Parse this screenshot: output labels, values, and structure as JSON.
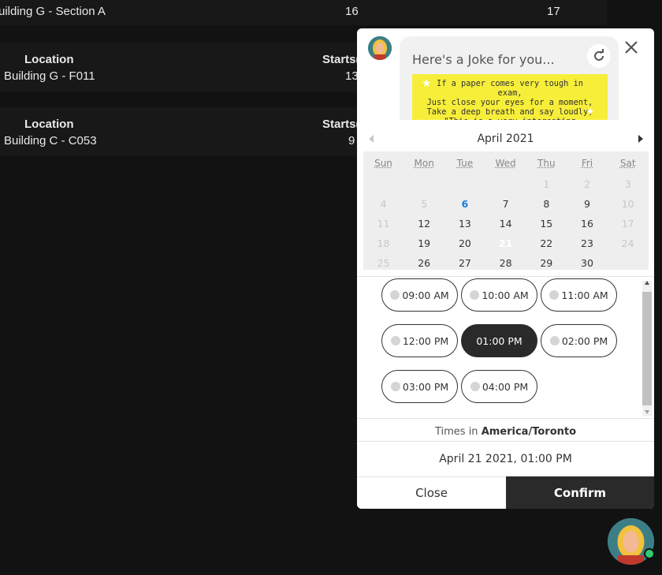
{
  "background_table": {
    "row1": {
      "location": "uilding G - Section A",
      "start": "16",
      "end": "17"
    },
    "row2": {
      "location_header": "Location",
      "starts_header": "Starts(",
      "location": "Building G - F011",
      "start": "13"
    },
    "row3": {
      "location_header": "Location",
      "starts_header": "Starts(",
      "location": "Building C - C053",
      "start": "9"
    }
  },
  "widget": {
    "joke_title": "Here's a Joke for you...",
    "joke_text_lines": [
      "If a paper comes very tough in",
      "exam,",
      "Just close your eyes for a moment,",
      "Take a deep breath and say loudly,",
      "\"This is a very interesting"
    ],
    "calendar": {
      "month_year": "April  2021",
      "weekdays": [
        "Sun",
        "Mon",
        "Tue",
        "Wed",
        "Thu",
        "Fri",
        "Sat"
      ],
      "weeks": [
        [
          {
            "d": "",
            "s": "dis"
          },
          {
            "d": "",
            "s": "dis"
          },
          {
            "d": "",
            "s": "dis"
          },
          {
            "d": "",
            "s": "dis"
          },
          {
            "d": "1",
            "s": "dis"
          },
          {
            "d": "2",
            "s": "dis"
          },
          {
            "d": "3",
            "s": "dis"
          }
        ],
        [
          {
            "d": "4",
            "s": "dis"
          },
          {
            "d": "5",
            "s": "dis"
          },
          {
            "d": "6",
            "s": "today"
          },
          {
            "d": "7",
            "s": ""
          },
          {
            "d": "8",
            "s": ""
          },
          {
            "d": "9",
            "s": ""
          },
          {
            "d": "10",
            "s": "dis"
          }
        ],
        [
          {
            "d": "11",
            "s": "dis"
          },
          {
            "d": "12",
            "s": ""
          },
          {
            "d": "13",
            "s": ""
          },
          {
            "d": "14",
            "s": ""
          },
          {
            "d": "15",
            "s": ""
          },
          {
            "d": "16",
            "s": ""
          },
          {
            "d": "17",
            "s": "dis"
          }
        ],
        [
          {
            "d": "18",
            "s": "dis"
          },
          {
            "d": "19",
            "s": ""
          },
          {
            "d": "20",
            "s": ""
          },
          {
            "d": "21",
            "s": "sel"
          },
          {
            "d": "22",
            "s": ""
          },
          {
            "d": "23",
            "s": ""
          },
          {
            "d": "24",
            "s": "dis"
          }
        ],
        [
          {
            "d": "25",
            "s": "dis"
          },
          {
            "d": "26",
            "s": ""
          },
          {
            "d": "27",
            "s": ""
          },
          {
            "d": "28",
            "s": ""
          },
          {
            "d": "29",
            "s": ""
          },
          {
            "d": "30",
            "s": ""
          },
          {
            "d": "",
            "s": "dis"
          }
        ]
      ]
    },
    "time_slots": [
      {
        "label": "09:00 AM",
        "selected": false
      },
      {
        "label": "10:00 AM",
        "selected": false
      },
      {
        "label": "11:00 AM",
        "selected": false
      },
      {
        "label": "12:00 PM",
        "selected": false
      },
      {
        "label": "01:00 PM",
        "selected": true
      },
      {
        "label": "02:00 PM",
        "selected": false
      },
      {
        "label": "03:00 PM",
        "selected": false
      },
      {
        "label": "04:00 PM",
        "selected": false
      }
    ],
    "timezone_prefix": "Times in",
    "timezone": "America/Toronto",
    "selected_datetime": "April 21 2021, 01:00 PM",
    "close_label": "Close",
    "confirm_label": "Confirm"
  },
  "colors": {
    "dark": "#2a2a2a",
    "today": "#1a7ed6",
    "joke_bg": "#f7ee3a",
    "online": "#2ecc71",
    "avatar_bg": "#3d7e86"
  },
  "icons": [
    "refresh-icon",
    "close-icon",
    "bot-avatar",
    "online-status-dot"
  ]
}
